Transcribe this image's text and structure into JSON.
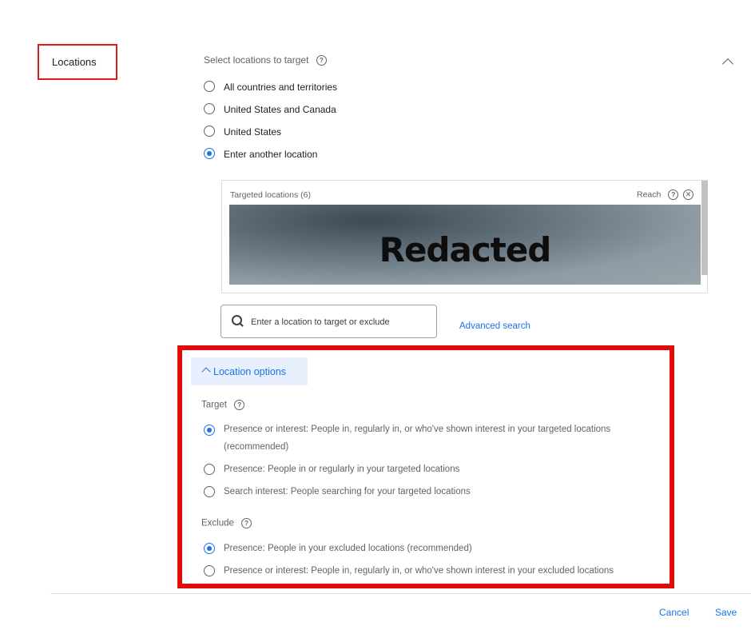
{
  "section": {
    "label": "Locations"
  },
  "select": {
    "heading": "Select locations to target",
    "options": [
      {
        "label": "All countries and territories",
        "selected": false
      },
      {
        "label": "United States and Canada",
        "selected": false
      },
      {
        "label": "United States",
        "selected": false
      },
      {
        "label": "Enter another location",
        "selected": true
      }
    ]
  },
  "targeted": {
    "header": "Targeted locations (6)",
    "reach_label": "Reach",
    "redacted_text": "Redacted"
  },
  "search": {
    "placeholder": "Enter a location to target or exclude",
    "advanced_link": "Advanced search"
  },
  "location_options": {
    "toggle_label": "Location options",
    "target_heading": "Target",
    "target_options": [
      {
        "label": "Presence or interest: People in, regularly in, or who've shown interest in your targeted locations",
        "sub": "(recommended)",
        "selected": true
      },
      {
        "label": "Presence: People in or regularly in your targeted locations",
        "selected": false
      },
      {
        "label": "Search interest: People searching for your targeted locations",
        "selected": false
      }
    ],
    "exclude_heading": "Exclude",
    "exclude_options": [
      {
        "label": "Presence: People in your excluded locations (recommended)",
        "selected": true
      },
      {
        "label": "Presence or interest: People in, regularly in, or who've shown interest in your excluded locations",
        "selected": false
      }
    ]
  },
  "footer": {
    "cancel": "Cancel",
    "save": "Save"
  },
  "colors": {
    "accent": "#1a73e8",
    "highlight_border": "#e10b0b",
    "chip_bg": "#e8f0fe"
  }
}
